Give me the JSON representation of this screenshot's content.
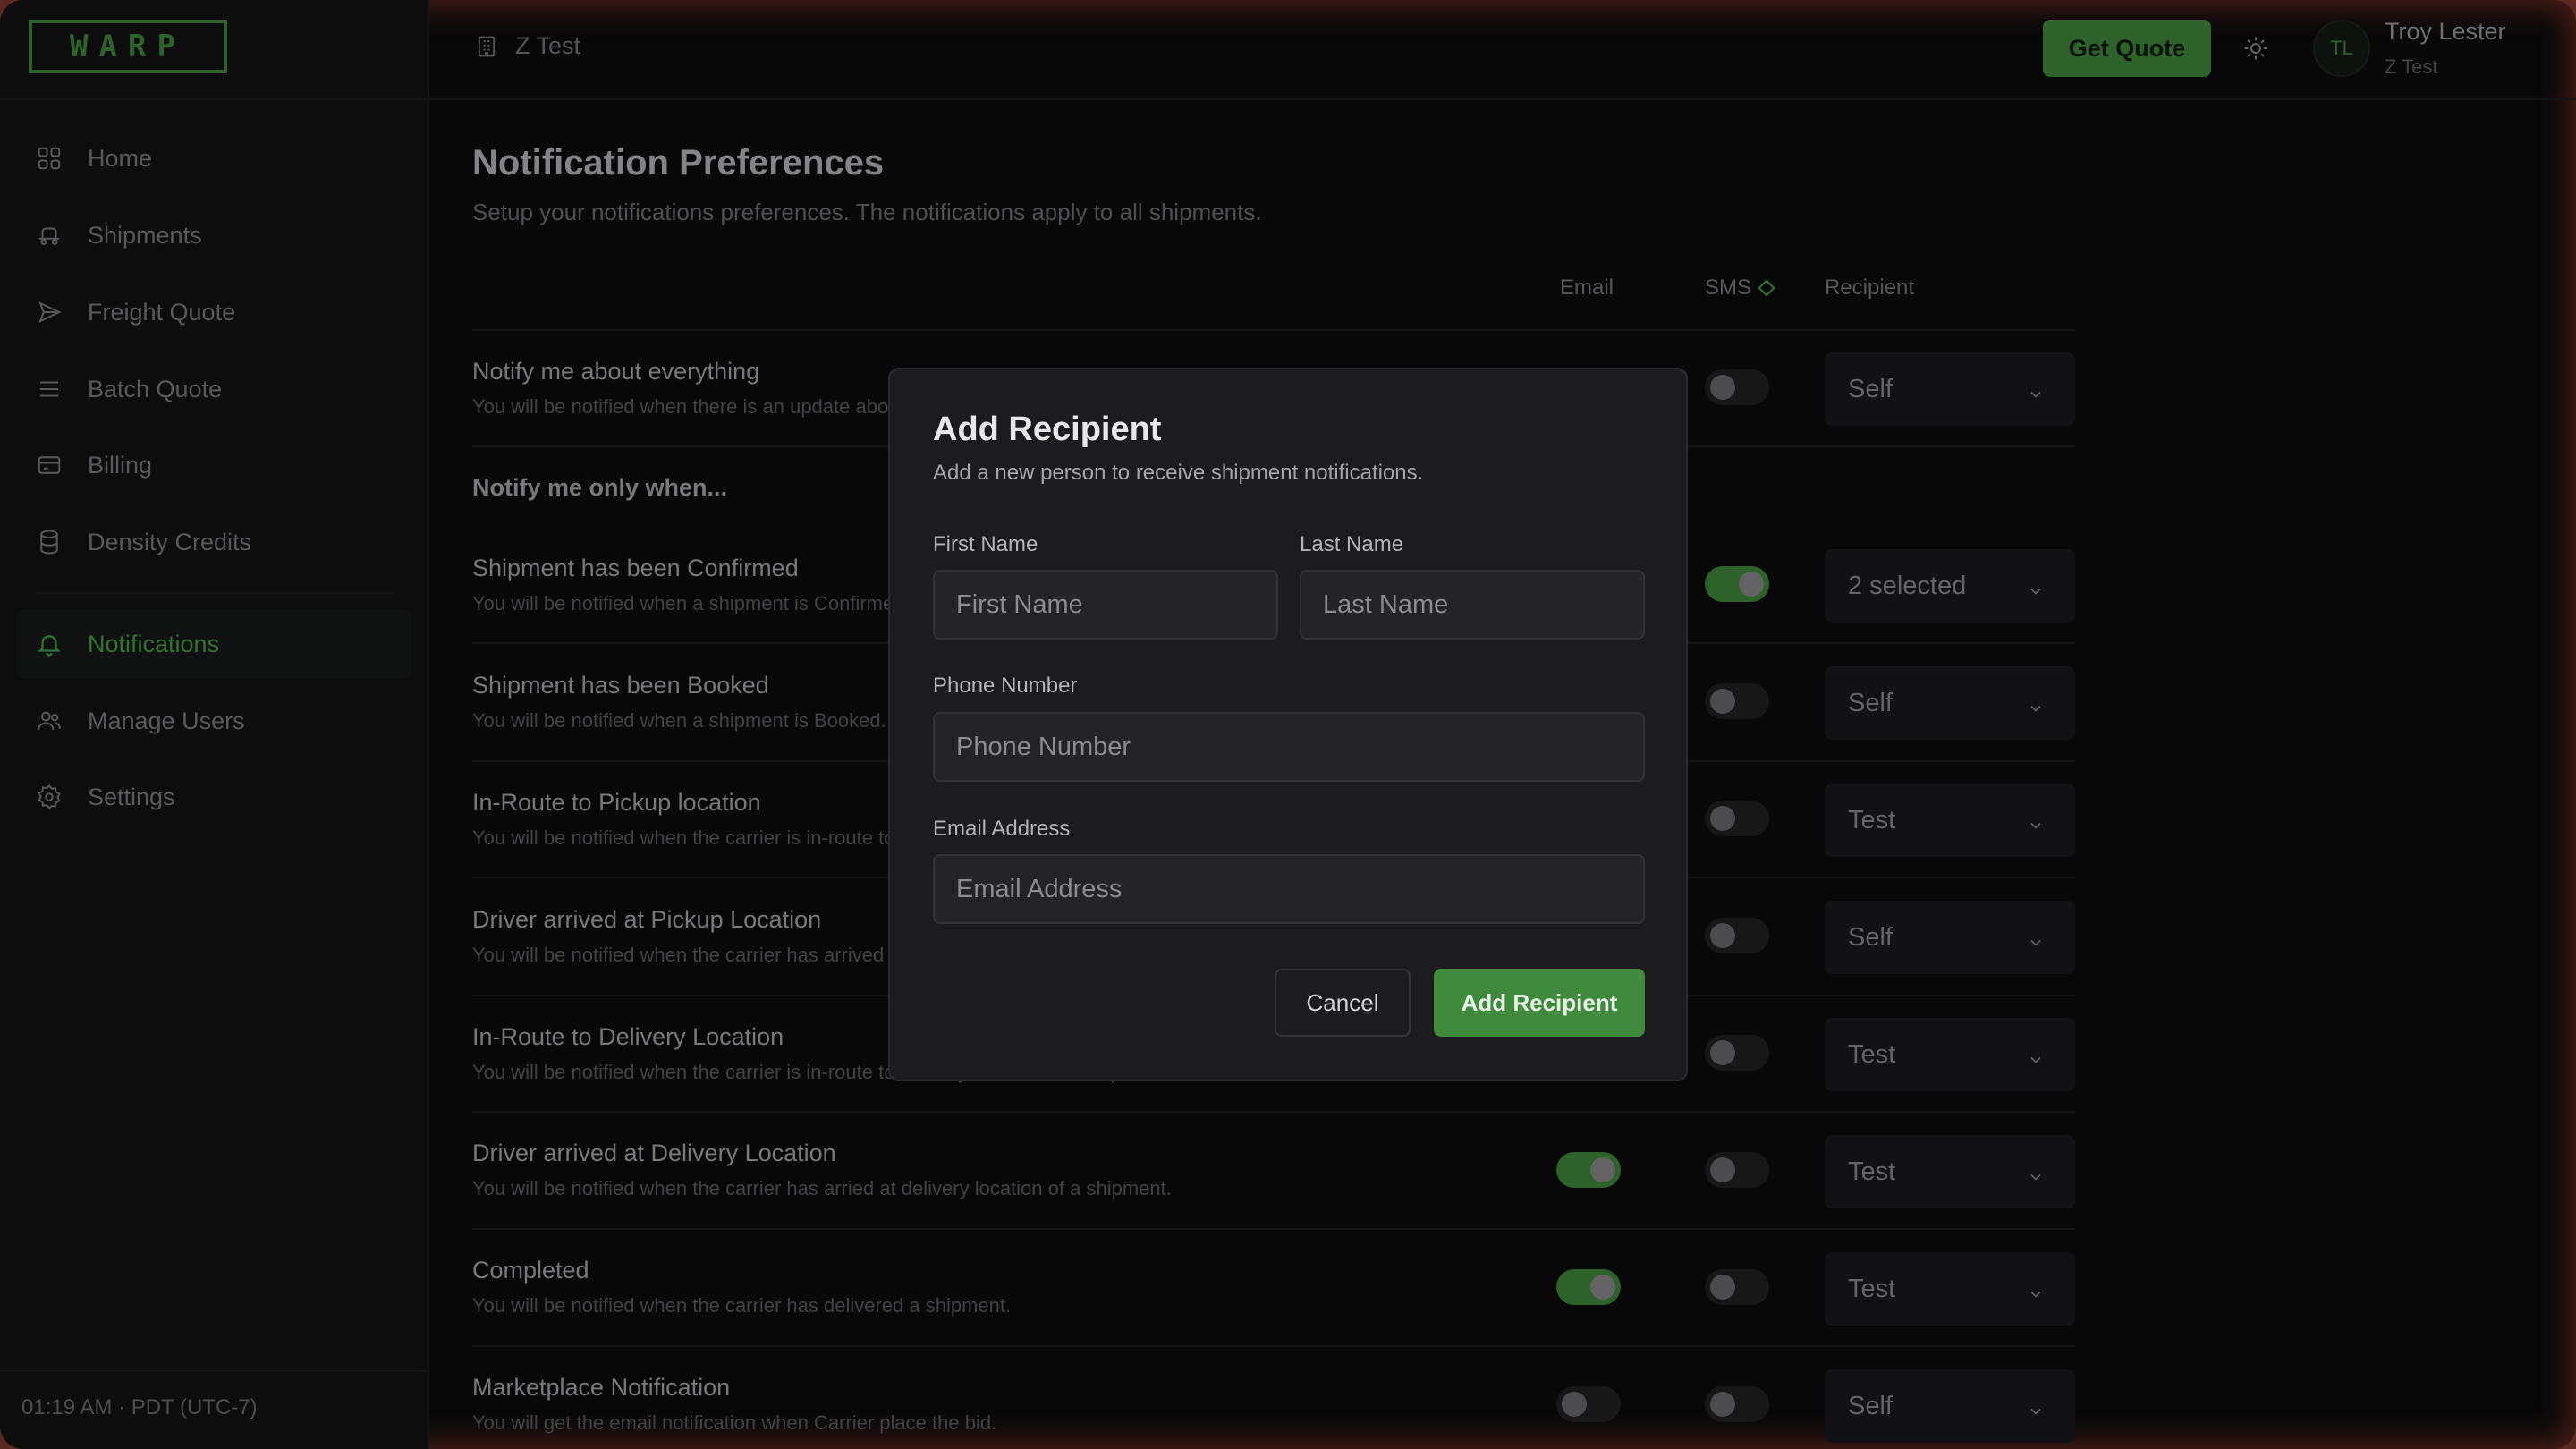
{
  "brand": {
    "logo_text": "WARP",
    "accent": "#3f8a3c"
  },
  "sidebar": {
    "items": [
      {
        "label": "Home",
        "icon": "grid-icon"
      },
      {
        "label": "Shipments",
        "icon": "truck-icon"
      },
      {
        "label": "Freight Quote",
        "icon": "send-icon"
      },
      {
        "label": "Batch Quote",
        "icon": "menu-lines-icon"
      },
      {
        "label": "Billing",
        "icon": "credit-card-icon"
      },
      {
        "label": "Density Credits",
        "icon": "database-icon"
      },
      {
        "label": "Notifications",
        "icon": "bell-icon",
        "active": true
      },
      {
        "label": "Manage Users",
        "icon": "users-icon"
      },
      {
        "label": "Settings",
        "icon": "gear-icon"
      }
    ],
    "timezone": "01:19 AM · PDT (UTC-7)"
  },
  "header": {
    "org_name": "Z Test",
    "get_quote": "Get Quote",
    "user_initials": "TL",
    "user_name": "Troy Lester",
    "user_org": "Z Test"
  },
  "page": {
    "title": "Notification Preferences",
    "subtitle": "Setup your notifications preferences. The notifications apply to all shipments.",
    "columns": {
      "email": "Email",
      "sms": "SMS",
      "recipient": "Recipient"
    },
    "group_label": "Notify me only when...",
    "rows": [
      {
        "title": "Notify me about everything",
        "desc": "You will be notified when there is an update about a shipment.",
        "email": false,
        "sms": false,
        "recipient": "Self"
      },
      {
        "title": "Shipment has been Confirmed",
        "desc": "You will be notified when a shipment is Confirmed.",
        "email": false,
        "sms": true,
        "recipient": "2 selected"
      },
      {
        "title": "Shipment has been Booked",
        "desc": "You will be notified when a shipment is Booked.",
        "email": false,
        "sms": false,
        "recipient": "Self"
      },
      {
        "title": "In-Route to Pickup location",
        "desc": "You will be notified when the carrier is in-route to pickup location of a shipment.",
        "email": false,
        "sms": false,
        "recipient": "Test"
      },
      {
        "title": "Driver arrived at Pickup Location",
        "desc": "You will be notified when the carrier has arrived at pickup location of a shipment.",
        "email": false,
        "sms": false,
        "recipient": "Self"
      },
      {
        "title": "In-Route to Delivery Location",
        "desc": "You will be notified when the carrier is in-route to delivery location of a shipment.",
        "email": false,
        "sms": false,
        "recipient": "Test"
      },
      {
        "title": "Driver arrived at Delivery Location",
        "desc": "You will be notified when the carrier has arried at delivery location of a shipment.",
        "email": true,
        "sms": false,
        "recipient": "Test"
      },
      {
        "title": "Completed",
        "desc": "You will be notified when the carrier has delivered a shipment.",
        "email": true,
        "sms": false,
        "recipient": "Test"
      },
      {
        "title": "Marketplace Notification",
        "desc": "You will get the email notification when Carrier place the bid.",
        "email": false,
        "sms": false,
        "recipient": "Self"
      }
    ]
  },
  "modal": {
    "title": "Add Recipient",
    "subtitle": "Add a new person to receive shipment notifications.",
    "first_name": {
      "label": "First Name",
      "placeholder": "First Name",
      "value": ""
    },
    "last_name": {
      "label": "Last Name",
      "placeholder": "Last Name",
      "value": ""
    },
    "phone": {
      "label": "Phone Number",
      "placeholder": "Phone Number",
      "value": ""
    },
    "email": {
      "label": "Email Address",
      "placeholder": "Email Address",
      "value": ""
    },
    "cancel": "Cancel",
    "submit": "Add Recipient"
  }
}
